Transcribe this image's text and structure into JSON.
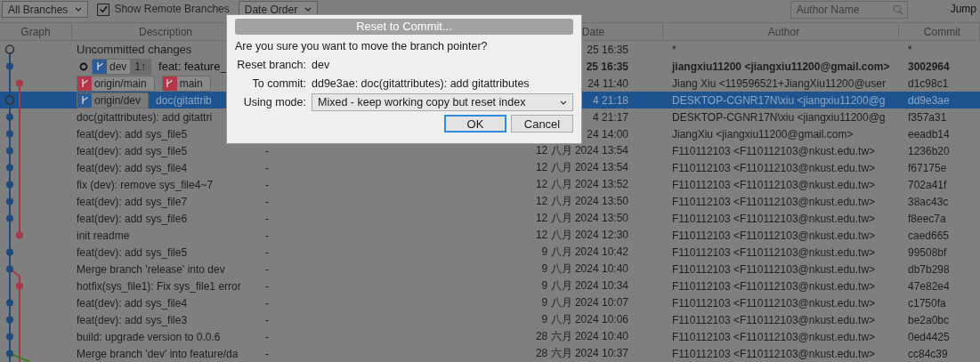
{
  "toolbar": {
    "branch_filter": "All Branches",
    "show_remote": {
      "label": "Show Remote Branches",
      "checked": true
    },
    "order": "Date Order",
    "author_search": {
      "placeholder": "Author Name"
    },
    "jump": "Jump"
  },
  "table": {
    "columns": [
      "Graph",
      "Description",
      "Date",
      "Author",
      "Commit"
    ],
    "rows": [
      {
        "selected": false,
        "current": false,
        "description": "Uncommitted changes",
        "date": "25 16:35",
        "author": "*",
        "commit": "*"
      },
      {
        "selected": false,
        "current": true,
        "head_marker": true,
        "tags": [
          {
            "name": "dev",
            "color": "#2b5c97",
            "count": "1↑"
          }
        ],
        "description": "feat: feature_",
        "date": "25 16:35",
        "author": "jiangxiu11200 <jiangxiu11200@gmail.com>",
        "commit": "3002964"
      },
      {
        "selected": false,
        "current": false,
        "tags": [
          {
            "name": "origin/main",
            "color": "#b3364a"
          },
          {
            "name": "main",
            "color": "#b3364a"
          }
        ],
        "date": "24 11:40",
        "author": "Jiang Xiu <119596521+JiangXiu11200@user",
        "commit": "d1c98c1"
      },
      {
        "selected": true,
        "current": false,
        "tags": [
          {
            "name": "origin/dev",
            "color": "#2b5c97"
          }
        ],
        "description": "doc(gitattrib",
        "date": "4 21:18",
        "author": "DESKTOP-CGNR17N\\xiu <jiangxiu11200@g",
        "commit": "dd9e3ae"
      },
      {
        "selected": false,
        "current": false,
        "description": "doc(gitattributes): add gitattri",
        "date": "4 21:17",
        "author": "DESKTOP-CGNR17N\\xiu <jiangxiu11200@g",
        "commit": "f357a31"
      },
      {
        "selected": false,
        "current": false,
        "description": "feat(dev): add sys_file5",
        "date": "24 14:00",
        "author": "JiangXiu <jiangxiu11200@gmail.com>",
        "commit": "eeadb14"
      },
      {
        "selected": false,
        "current": false,
        "description": "feat(dev): add sys_file5",
        "column_3": "-",
        "date": "12 八月 2024 13:54",
        "author": "F110112103 <F110112103@nkust.edu.tw>",
        "commit": "1236b20"
      },
      {
        "selected": false,
        "current": false,
        "description": "feat(dev): add sys_file4",
        "column_3": "-",
        "date": "12 八月 2024 13:54",
        "author": "F110112103 <F110112103@nkust.edu.tw>",
        "commit": "f67175e"
      },
      {
        "selected": false,
        "current": false,
        "description": "fix (dev): remove sys_file4~7",
        "column_3": "-",
        "date": "12 八月 2024 13:52",
        "author": "F110112103 <F110112103@nkust.edu.tw>",
        "commit": "702a41f"
      },
      {
        "selected": false,
        "current": false,
        "description": "feat(dev): add sys_file7",
        "column_3": "-",
        "date": "12 八月 2024 13:50",
        "author": "F110112103 <F110112103@nkust.edu.tw>",
        "commit": "38ac43c"
      },
      {
        "selected": false,
        "current": false,
        "description": "feat(dev): add sys_file6",
        "column_3": "-",
        "date": "12 八月 2024 13:50",
        "author": "F110112103 <F110112103@nkust.edu.tw>",
        "commit": "f8eec7a"
      },
      {
        "selected": false,
        "current": false,
        "description": "init readme",
        "column_3": "-",
        "date": "12 八月 2024 12:30",
        "author": "F110112103 <F110112103@nkust.edu.tw>",
        "commit": "caed665"
      },
      {
        "selected": false,
        "current": false,
        "description": "feat(dev): add sys_file5",
        "column_3": "-",
        "date": "9 八月 2024 10:42",
        "author": "F110112103 <F110112103@nkust.edu.tw>",
        "commit": "99508bf"
      },
      {
        "selected": false,
        "current": false,
        "description": "Merge branch 'release' into dev",
        "column_3": "-",
        "date": "9 八月 2024 10:40",
        "author": "F110112103 <F110112103@nkust.edu.tw>",
        "commit": "db7b298"
      },
      {
        "selected": false,
        "current": false,
        "description": "hotfix(sys_file1): Fix sys_file1 error",
        "column_3": "-",
        "date": "9 八月 2024 10:34",
        "author": "F110112103 <F110112103@nkust.edu.tw>",
        "commit": "47e82e4"
      },
      {
        "selected": false,
        "current": false,
        "description": "feat(dev): add sys_file4",
        "column_3": "-",
        "date": "9 八月 2024 10:07",
        "author": "F110112103 <F110112103@nkust.edu.tw>",
        "commit": "c1750fa"
      },
      {
        "selected": false,
        "current": false,
        "description": "feat(dev): add sys_file3",
        "column_3": "-",
        "date": "9 八月 2024 10:06",
        "author": "F110112103 <F110112103@nkust.edu.tw>",
        "commit": "be2a0bc"
      },
      {
        "selected": false,
        "current": false,
        "description": "build: upgrade version to 0.0.6",
        "column_3": "-",
        "date": "28 六月 2024 10:40",
        "author": "F110112103 <F110112103@nkust.edu.tw>",
        "commit": "0ed4425"
      },
      {
        "selected": false,
        "current": false,
        "description": "Merge branch 'dev' into feature/da",
        "column_3": "-",
        "date": "28 六月 2024 10:37",
        "author": "F110112103 <F110112103@nkust.edu.tw>",
        "commit": "cc84c39"
      }
    ]
  },
  "dialog": {
    "title": "Reset to Commit...",
    "question": "Are you sure you want to move the branch pointer?",
    "fields": [
      {
        "label": "Reset branch:",
        "value": "dev"
      },
      {
        "label": "To commit:",
        "value": "dd9e3ae: doc(gitattributes): add gitattributes"
      }
    ],
    "mode": {
      "label": "Using mode:",
      "value": "Mixed - keep working copy but reset index"
    },
    "buttons": [
      {
        "label": "OK",
        "default": true
      },
      {
        "label": "Cancel",
        "default": false
      }
    ]
  }
}
